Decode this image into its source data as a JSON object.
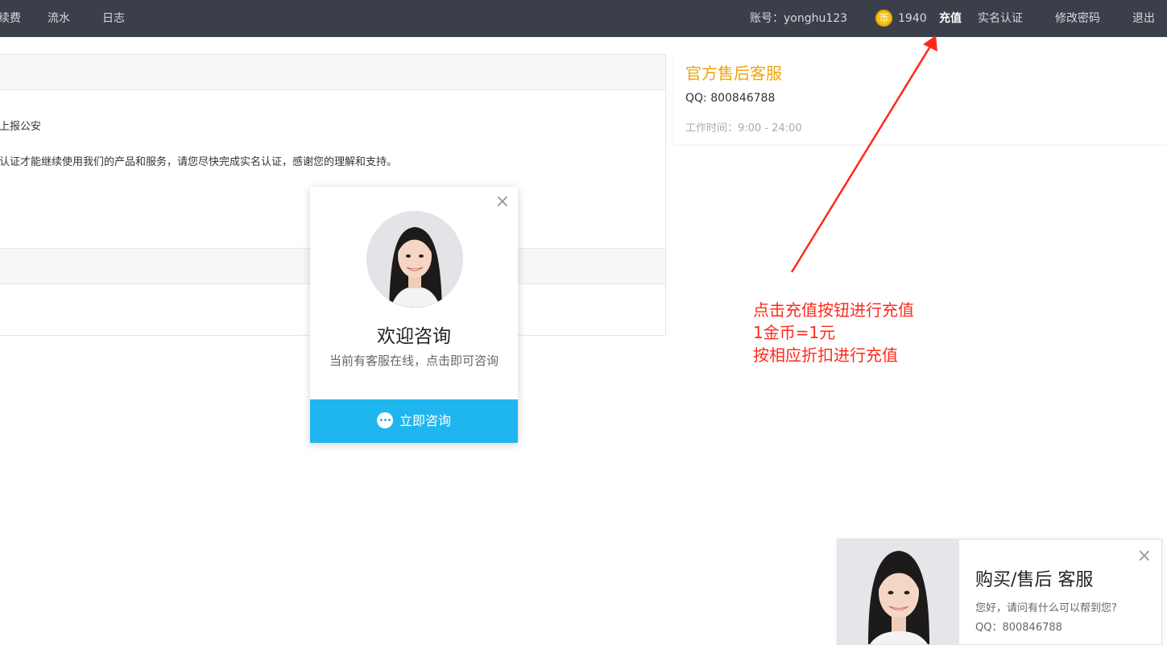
{
  "nav": {
    "left_items": [
      "续费",
      "流水",
      "日志"
    ],
    "account_label": "账号：",
    "account_value": "yonghu123",
    "coin_icon_text": "币",
    "coins": "1940",
    "recharge": "充值",
    "verify": "实名认证",
    "change_password": "修改密码",
    "logout": "退出"
  },
  "main": {
    "line1": "上报公安",
    "line2": "认证才能继续使用我们的产品和服务，请您尽快完成实名认证，感谢您的理解和支持。"
  },
  "service_card": {
    "title": "官方售后客服",
    "qq": "QQ: 800846788",
    "hours": "工作时间：9:00 - 24:00"
  },
  "annotation": {
    "line1": "点击充值按钮进行充值",
    "line2": "1金币=1元",
    "line3": "按相应折扣进行充值",
    "color": "#ff2a1a"
  },
  "popup": {
    "title": "欢迎咨询",
    "subtitle": "当前有客服在线，点击即可咨询",
    "button": "立即咨询",
    "close": "×",
    "accent": "#1fb6f0"
  },
  "bottom_card": {
    "title": "购买/售后 客服",
    "greeting": "您好，请问有什么可以帮到您?",
    "qq": "QQ：800846788",
    "close": "×"
  }
}
